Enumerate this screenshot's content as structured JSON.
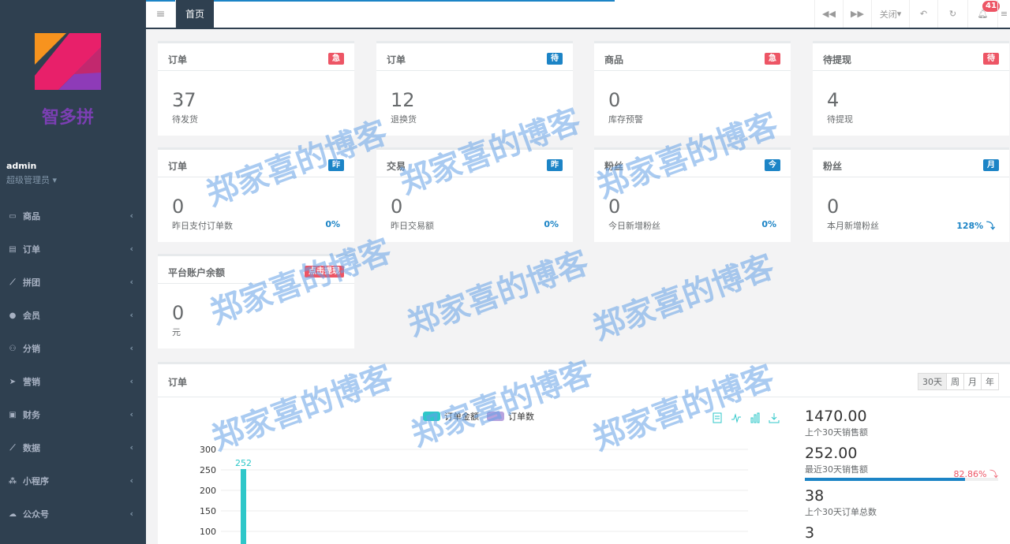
{
  "sidebar": {
    "logo_text": "智多拼",
    "user_name": "admin",
    "user_role": "超级管理员",
    "items": [
      {
        "label": "商品",
        "icon": "monitor-icon"
      },
      {
        "label": "订单",
        "icon": "file-icon"
      },
      {
        "label": "拼团",
        "icon": "chart-icon"
      },
      {
        "label": "会员",
        "icon": "user-icon"
      },
      {
        "label": "分销",
        "icon": "users-icon"
      },
      {
        "label": "营销",
        "icon": "send-icon"
      },
      {
        "label": "财务",
        "icon": "money-icon"
      },
      {
        "label": "数据",
        "icon": "chart-icon"
      },
      {
        "label": "小程序",
        "icon": "cubes-icon"
      },
      {
        "label": "公众号",
        "icon": "wechat-icon"
      }
    ]
  },
  "topbar": {
    "home_tab": "首页",
    "close_label": "关闭",
    "notification_count": "41"
  },
  "cards": [
    {
      "title": "订单",
      "badge": "急",
      "value": "37",
      "desc": "待发货",
      "pct": ""
    },
    {
      "title": "订单",
      "badge": "待",
      "value": "12",
      "desc": "退换货",
      "pct": ""
    },
    {
      "title": "商品",
      "badge": "急",
      "value": "0",
      "desc": "库存预警",
      "pct": ""
    },
    {
      "title": "待提现",
      "badge": "待",
      "value": "4",
      "desc": "待提现",
      "pct": ""
    },
    {
      "title": "订单",
      "badge": "昨",
      "value": "0",
      "desc": "昨日支付订单数",
      "pct": "0%"
    },
    {
      "title": "交易",
      "badge": "昨",
      "value": "0",
      "desc": "昨日交易额",
      "pct": "0%"
    },
    {
      "title": "粉丝",
      "badge": "今",
      "value": "0",
      "desc": "今日新增粉丝",
      "pct": "0%"
    },
    {
      "title": "粉丝",
      "badge": "月",
      "value": "0",
      "desc": "本月新增粉丝",
      "pct": "128% ⤵"
    },
    {
      "title": "平台账户余额",
      "badge": "点击提现",
      "value": "0",
      "desc": "元",
      "pct": ""
    }
  ],
  "chart_panel": {
    "title": "订单",
    "ranges": [
      "30天",
      "周",
      "月",
      "年"
    ],
    "legend": [
      "订单金额",
      "订单数"
    ],
    "stats": [
      {
        "value": "1470.00",
        "label": "上个30天销售额",
        "pct": ""
      },
      {
        "value": "252.00",
        "label": "最近30天销售额",
        "pct": "82.86% ⤵"
      },
      {
        "value": "38",
        "label": "上个30天订单总数",
        "pct": ""
      },
      {
        "value": "3",
        "label": "",
        "pct": ""
      }
    ]
  },
  "watermark": "郑家喜的博客",
  "colors": {
    "sidebar": "#2f4050",
    "blue": "#1c84c6",
    "red": "#ed5565",
    "teal": "#2ec7c9",
    "purple": "#b6a2de"
  },
  "chart_data": {
    "type": "bar",
    "y_ticks": [
      "300",
      "250",
      "200",
      "150",
      "100"
    ],
    "ylim": [
      0,
      300
    ],
    "series": [
      {
        "name": "订单金额",
        "values": [
          252
        ]
      },
      {
        "name": "订单数",
        "values": []
      }
    ],
    "data_labels": [
      "252"
    ]
  }
}
